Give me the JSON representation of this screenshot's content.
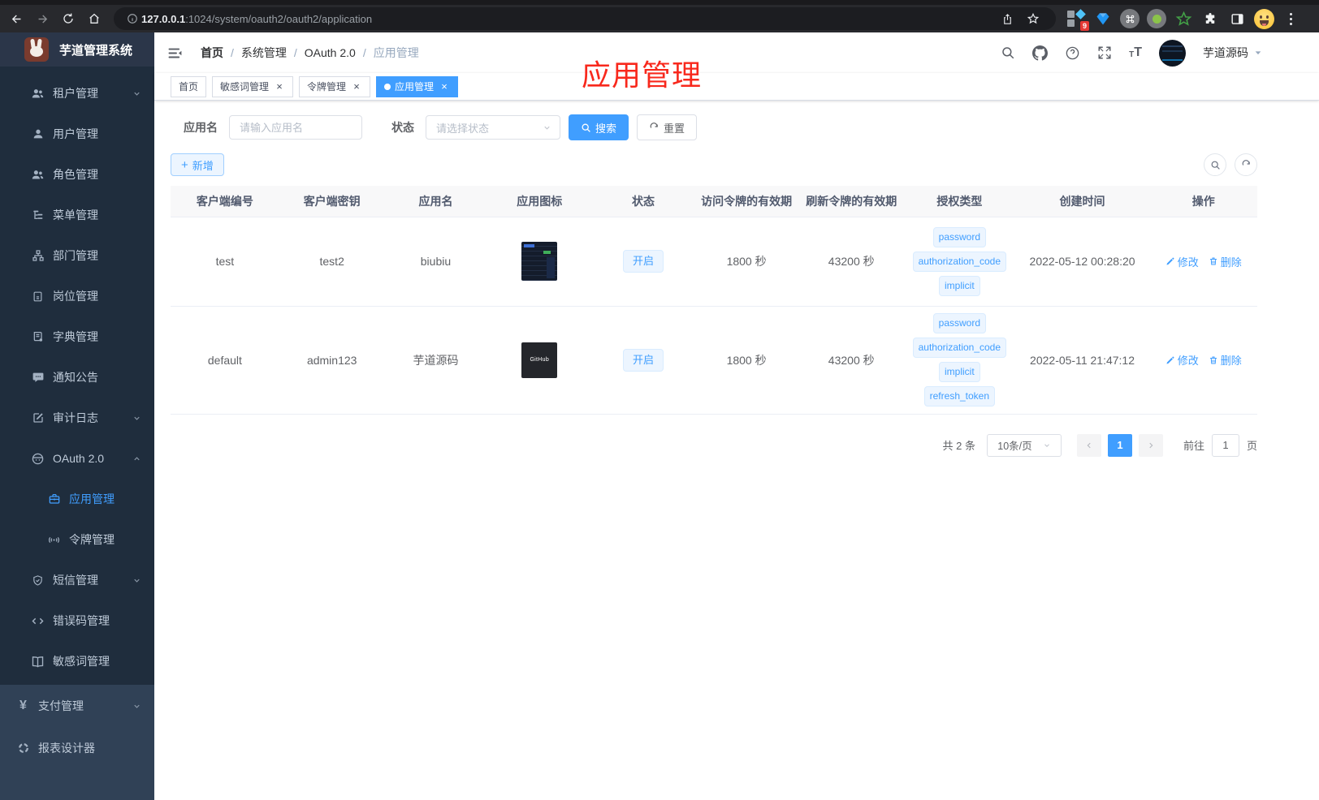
{
  "browser": {
    "url_host": "127.0.0.1",
    "url_path": ":1024/system/oauth2/oauth2/application",
    "extension_badge": "9"
  },
  "sidebar": {
    "logo_title": "芋道管理系统",
    "items": [
      {
        "label": "租户管理",
        "icon": "users-icon",
        "arrow": "down"
      },
      {
        "label": "用户管理",
        "icon": "user-icon"
      },
      {
        "label": "角色管理",
        "icon": "users-icon"
      },
      {
        "label": "菜单管理",
        "icon": "menu-tree-icon"
      },
      {
        "label": "部门管理",
        "icon": "org-tree-icon"
      },
      {
        "label": "岗位管理",
        "icon": "badge-icon"
      },
      {
        "label": "字典管理",
        "icon": "dictionary-icon"
      },
      {
        "label": "通知公告",
        "icon": "message-icon"
      },
      {
        "label": "审计日志",
        "icon": "audit-log-icon",
        "arrow": "down"
      },
      {
        "label": "OAuth 2.0",
        "icon": "robot-icon",
        "arrow": "up"
      },
      {
        "label": "应用管理",
        "icon": "briefcase-icon",
        "active": true
      },
      {
        "label": "令牌管理",
        "icon": "broadcast-icon"
      },
      {
        "label": "短信管理",
        "icon": "shield-icon",
        "arrow": "down"
      },
      {
        "label": "错误码管理",
        "icon": "code-icon"
      },
      {
        "label": "敏感词管理",
        "icon": "open-book-icon"
      },
      {
        "label": "支付管理",
        "icon": "yen-icon",
        "arrow": "down"
      },
      {
        "label": "报表设计器",
        "icon": "report-icon"
      }
    ]
  },
  "navbar": {
    "breadcrumb": [
      {
        "label": "首页"
      },
      {
        "label": "系统管理"
      },
      {
        "label": "OAuth 2.0"
      },
      {
        "label": "应用管理"
      }
    ],
    "separator": "/",
    "username": "芋道源码"
  },
  "annotation": {
    "text": "应用管理",
    "color": "#f8281c"
  },
  "tags_view": {
    "tabs": [
      {
        "label": "首页",
        "closable": false,
        "active": false
      },
      {
        "label": "敏感词管理",
        "closable": true,
        "active": false
      },
      {
        "label": "令牌管理",
        "closable": true,
        "active": false
      },
      {
        "label": "应用管理",
        "closable": true,
        "active": true
      }
    ]
  },
  "filters": {
    "name_label": "应用名",
    "name_placeholder": "请输入应用名",
    "status_label": "状态",
    "status_placeholder": "请选择状态",
    "search_button": "搜索",
    "reset_button": "重置",
    "add_button": "新增"
  },
  "table": {
    "headers": [
      "客户端编号",
      "客户端密钥",
      "应用名",
      "应用图标",
      "状态",
      "访问令牌的有效期",
      "刷新令牌的有效期",
      "授权类型",
      "创建时间",
      "操作"
    ],
    "rows": [
      {
        "client_id": "test",
        "client_secret": "test2",
        "app_name": "biubiu",
        "status": "开启",
        "access_token_ttl": "1800 秒",
        "refresh_token_ttl": "43200 秒",
        "grants": [
          "password",
          "authorization_code",
          "implicit"
        ],
        "create_time": "2022-05-12 00:28:20"
      },
      {
        "client_id": "default",
        "client_secret": "admin123",
        "app_name": "芋道源码",
        "icon_text": "GitHub",
        "status": "开启",
        "access_token_ttl": "1800 秒",
        "refresh_token_ttl": "43200 秒",
        "grants": [
          "password",
          "authorization_code",
          "implicit",
          "refresh_token"
        ],
        "create_time": "2022-05-11 21:47:12"
      }
    ],
    "edit_action": "修改",
    "delete_action": "删除"
  },
  "pagination": {
    "total": "共 2 条",
    "page_size": "10条/页",
    "current_page": "1",
    "goto_prefix": "前往",
    "goto_value": "1",
    "goto_suffix": "页"
  },
  "colors": {
    "primary": "#409eff",
    "sidebar_bg": "#304156",
    "submenu_bg": "#1f2d3d",
    "tag_bg": "#ecf5ff",
    "annotation_red": "#f8281c"
  }
}
